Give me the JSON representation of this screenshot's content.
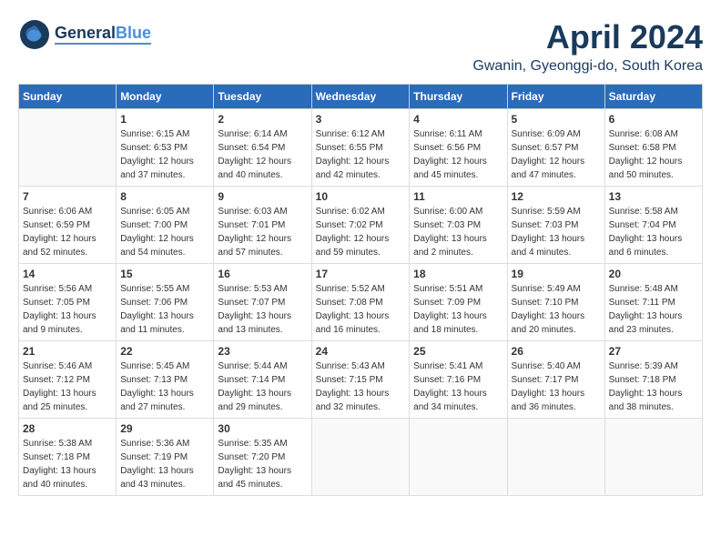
{
  "header": {
    "logo_general": "General",
    "logo_blue": "Blue",
    "month_title": "April 2024",
    "location": "Gwanin, Gyeonggi-do, South Korea"
  },
  "weekdays": [
    "Sunday",
    "Monday",
    "Tuesday",
    "Wednesday",
    "Thursday",
    "Friday",
    "Saturday"
  ],
  "weeks": [
    [
      {
        "day": "",
        "info": ""
      },
      {
        "day": "1",
        "info": "Sunrise: 6:15 AM\nSunset: 6:53 PM\nDaylight: 12 hours\nand 37 minutes."
      },
      {
        "day": "2",
        "info": "Sunrise: 6:14 AM\nSunset: 6:54 PM\nDaylight: 12 hours\nand 40 minutes."
      },
      {
        "day": "3",
        "info": "Sunrise: 6:12 AM\nSunset: 6:55 PM\nDaylight: 12 hours\nand 42 minutes."
      },
      {
        "day": "4",
        "info": "Sunrise: 6:11 AM\nSunset: 6:56 PM\nDaylight: 12 hours\nand 45 minutes."
      },
      {
        "day": "5",
        "info": "Sunrise: 6:09 AM\nSunset: 6:57 PM\nDaylight: 12 hours\nand 47 minutes."
      },
      {
        "day": "6",
        "info": "Sunrise: 6:08 AM\nSunset: 6:58 PM\nDaylight: 12 hours\nand 50 minutes."
      }
    ],
    [
      {
        "day": "7",
        "info": "Sunrise: 6:06 AM\nSunset: 6:59 PM\nDaylight: 12 hours\nand 52 minutes."
      },
      {
        "day": "8",
        "info": "Sunrise: 6:05 AM\nSunset: 7:00 PM\nDaylight: 12 hours\nand 54 minutes."
      },
      {
        "day": "9",
        "info": "Sunrise: 6:03 AM\nSunset: 7:01 PM\nDaylight: 12 hours\nand 57 minutes."
      },
      {
        "day": "10",
        "info": "Sunrise: 6:02 AM\nSunset: 7:02 PM\nDaylight: 12 hours\nand 59 minutes."
      },
      {
        "day": "11",
        "info": "Sunrise: 6:00 AM\nSunset: 7:03 PM\nDaylight: 13 hours\nand 2 minutes."
      },
      {
        "day": "12",
        "info": "Sunrise: 5:59 AM\nSunset: 7:03 PM\nDaylight: 13 hours\nand 4 minutes."
      },
      {
        "day": "13",
        "info": "Sunrise: 5:58 AM\nSunset: 7:04 PM\nDaylight: 13 hours\nand 6 minutes."
      }
    ],
    [
      {
        "day": "14",
        "info": "Sunrise: 5:56 AM\nSunset: 7:05 PM\nDaylight: 13 hours\nand 9 minutes."
      },
      {
        "day": "15",
        "info": "Sunrise: 5:55 AM\nSunset: 7:06 PM\nDaylight: 13 hours\nand 11 minutes."
      },
      {
        "day": "16",
        "info": "Sunrise: 5:53 AM\nSunset: 7:07 PM\nDaylight: 13 hours\nand 13 minutes."
      },
      {
        "day": "17",
        "info": "Sunrise: 5:52 AM\nSunset: 7:08 PM\nDaylight: 13 hours\nand 16 minutes."
      },
      {
        "day": "18",
        "info": "Sunrise: 5:51 AM\nSunset: 7:09 PM\nDaylight: 13 hours\nand 18 minutes."
      },
      {
        "day": "19",
        "info": "Sunrise: 5:49 AM\nSunset: 7:10 PM\nDaylight: 13 hours\nand 20 minutes."
      },
      {
        "day": "20",
        "info": "Sunrise: 5:48 AM\nSunset: 7:11 PM\nDaylight: 13 hours\nand 23 minutes."
      }
    ],
    [
      {
        "day": "21",
        "info": "Sunrise: 5:46 AM\nSunset: 7:12 PM\nDaylight: 13 hours\nand 25 minutes."
      },
      {
        "day": "22",
        "info": "Sunrise: 5:45 AM\nSunset: 7:13 PM\nDaylight: 13 hours\nand 27 minutes."
      },
      {
        "day": "23",
        "info": "Sunrise: 5:44 AM\nSunset: 7:14 PM\nDaylight: 13 hours\nand 29 minutes."
      },
      {
        "day": "24",
        "info": "Sunrise: 5:43 AM\nSunset: 7:15 PM\nDaylight: 13 hours\nand 32 minutes."
      },
      {
        "day": "25",
        "info": "Sunrise: 5:41 AM\nSunset: 7:16 PM\nDaylight: 13 hours\nand 34 minutes."
      },
      {
        "day": "26",
        "info": "Sunrise: 5:40 AM\nSunset: 7:17 PM\nDaylight: 13 hours\nand 36 minutes."
      },
      {
        "day": "27",
        "info": "Sunrise: 5:39 AM\nSunset: 7:18 PM\nDaylight: 13 hours\nand 38 minutes."
      }
    ],
    [
      {
        "day": "28",
        "info": "Sunrise: 5:38 AM\nSunset: 7:18 PM\nDaylight: 13 hours\nand 40 minutes."
      },
      {
        "day": "29",
        "info": "Sunrise: 5:36 AM\nSunset: 7:19 PM\nDaylight: 13 hours\nand 43 minutes."
      },
      {
        "day": "30",
        "info": "Sunrise: 5:35 AM\nSunset: 7:20 PM\nDaylight: 13 hours\nand 45 minutes."
      },
      {
        "day": "",
        "info": ""
      },
      {
        "day": "",
        "info": ""
      },
      {
        "day": "",
        "info": ""
      },
      {
        "day": "",
        "info": ""
      }
    ]
  ]
}
